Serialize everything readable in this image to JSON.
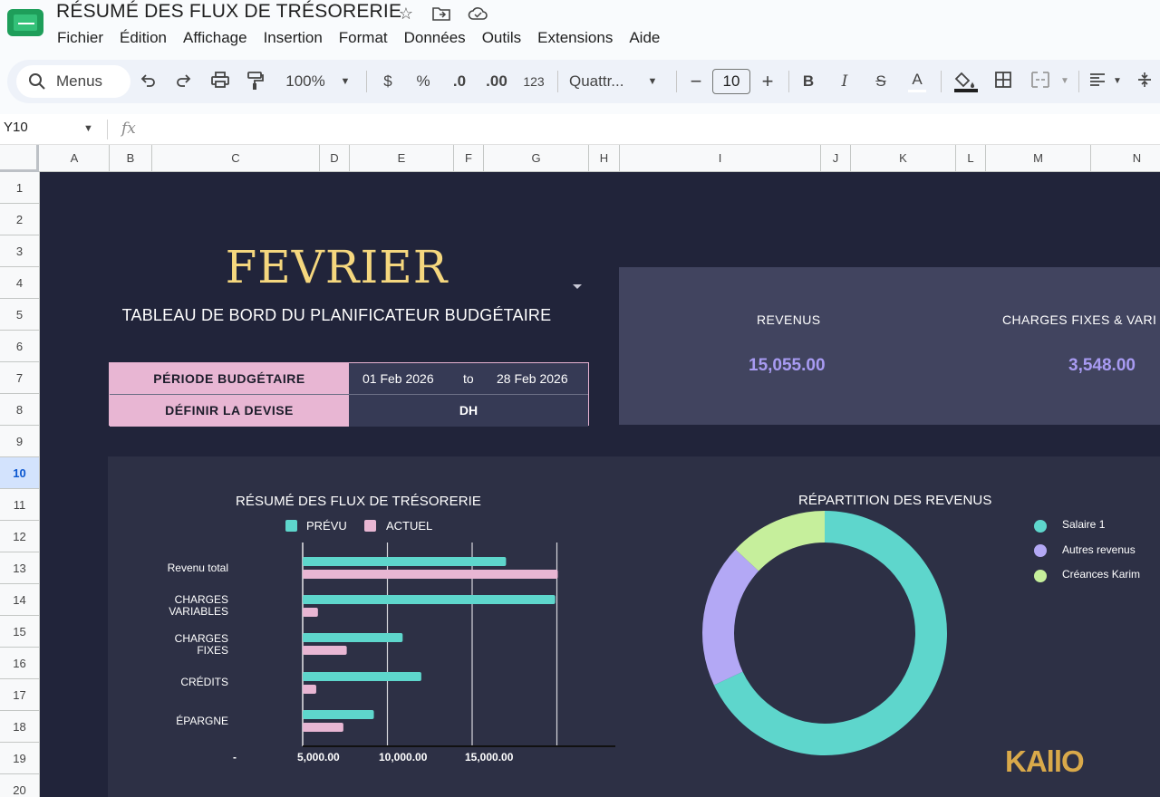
{
  "app": {
    "title": "RÉSUMÉ DES FLUX DE TRÉSORERIE",
    "menu": [
      "Fichier",
      "Édition",
      "Affichage",
      "Insertion",
      "Format",
      "Données",
      "Outils",
      "Extensions",
      "Aide"
    ]
  },
  "toolbar": {
    "search_label": "Menus",
    "zoom": "100%",
    "currency": "$",
    "percent": "%",
    "dec_decrease": ".0",
    "dec_increase": ".00",
    "number_format": "123",
    "font": "Quattr...",
    "font_size": "10",
    "minus": "−",
    "plus": "+",
    "bold": "B",
    "italic": "I",
    "strike": "S",
    "text_color": "A"
  },
  "formula_bar": {
    "cell_ref": "Y10",
    "fx": "fx"
  },
  "grid": {
    "columns": [
      "A",
      "B",
      "C",
      "D",
      "E",
      "F",
      "G",
      "H",
      "I",
      "J",
      "K",
      "L",
      "M",
      "N"
    ],
    "rows": [
      "1",
      "2",
      "3",
      "4",
      "5",
      "6",
      "7",
      "8",
      "9",
      "10",
      "11",
      "12",
      "13",
      "14",
      "15",
      "16",
      "17",
      "18",
      "19",
      "20"
    ],
    "selected_row": "10"
  },
  "dashboard": {
    "month": "FEVRIER",
    "subtitle": "TABLEAU DE BORD DU PLANIFICATEUR BUDGÉTAIRE",
    "period_label": "PÉRIODE BUDGÉTAIRE",
    "period_start": "01 Feb 2026",
    "period_to": "to",
    "period_end": "28 Feb 2026",
    "currency_label": "DÉFINIR LA DEVISE",
    "currency_value": "DH",
    "summary": [
      {
        "label": "REVENUS",
        "value": "15,055.00"
      },
      {
        "label": "CHARGES FIXES &  VARI",
        "value": "3,548.00"
      }
    ],
    "brand": "KAllO"
  },
  "colors": {
    "background": "#21243a",
    "panel": "#2d3045",
    "planned": "#5ed6cc",
    "actual": "#e8b6d3",
    "accent_value": "#a89bf2",
    "month": "#f5d77e"
  },
  "chart_data": [
    {
      "type": "bar",
      "orientation": "horizontal",
      "title": "RÉSUMÉ DES FLUX DE TRÉSORERIE",
      "categories": [
        "Revenu total",
        "CHARGES\nVARIABLES",
        "CHARGES\nFIXES",
        "CRÉDITS",
        "ÉPARGNE"
      ],
      "series": [
        {
          "name": "PRÉVU",
          "color": "#5ed6cc",
          "values": [
            12000,
            14900,
            5900,
            7000,
            4200
          ]
        },
        {
          "name": "ACTUEL",
          "color": "#e8b6d3",
          "values": [
            15055,
            900,
            2600,
            800,
            2400
          ]
        }
      ],
      "xlim": [
        0,
        20000
      ],
      "xticks": [
        "-",
        "5,000.00",
        "10,000.00",
        "15,000.00"
      ],
      "legend": "top",
      "grid": true
    },
    {
      "type": "pie",
      "donut": true,
      "title": "RÉPARTITION DES REVENUS",
      "labels": [
        "Salaire 1",
        "Autres revenus",
        "Créances Karim"
      ],
      "values": [
        68,
        19,
        13
      ],
      "colors": [
        "#5ed6cc",
        "#b3a8f5",
        "#c6ef9c"
      ],
      "legend": "right"
    }
  ]
}
